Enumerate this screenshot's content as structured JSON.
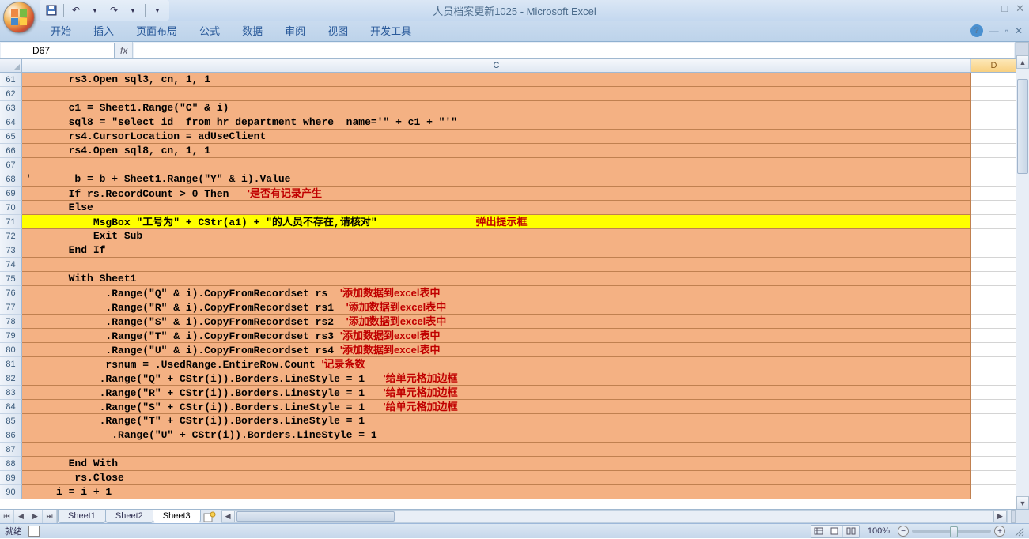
{
  "title": "人员档案更新1025 - Microsoft Excel",
  "qat": {
    "save": "save-icon",
    "undo": "undo-icon",
    "redo": "redo-icon"
  },
  "ribbon_tabs": [
    "开始",
    "插入",
    "页面布局",
    "公式",
    "数据",
    "审阅",
    "视图",
    "开发工具"
  ],
  "namebox": "D67",
  "formula_value": "",
  "columns": [
    "C",
    "D"
  ],
  "row_start": 61,
  "row_end": 90,
  "highlight_row": 71,
  "rows": [
    {
      "n": 61,
      "c": "       rs3.Open sql3, cn, 1, 1",
      "comment": ""
    },
    {
      "n": 62,
      "c": "",
      "comment": ""
    },
    {
      "n": 63,
      "c": "       c1 = Sheet1.Range(\"C\" & i)",
      "comment": ""
    },
    {
      "n": 64,
      "c": "       sql8 = \"select id  from hr_department where  name='\" + c1 + \"'\"",
      "comment": ""
    },
    {
      "n": 65,
      "c": "       rs4.CursorLocation = adUseClient",
      "comment": ""
    },
    {
      "n": 66,
      "c": "       rs4.Open sql8, cn, 1, 1",
      "comment": ""
    },
    {
      "n": 67,
      "c": "",
      "comment": ""
    },
    {
      "n": 68,
      "c": "'       b = b + Sheet1.Range(\"Y\" & i).Value",
      "comment": ""
    },
    {
      "n": 69,
      "c": "       If rs.RecordCount > 0 Then   ",
      "comment": "'是否有记录产生"
    },
    {
      "n": 70,
      "c": "       Else",
      "comment": ""
    },
    {
      "n": 71,
      "c": "           MsgBox \"工号为\" + CStr(a1) + \"的人员不存在,请核对\"                ",
      "comment": "弹出提示框"
    },
    {
      "n": 72,
      "c": "           Exit Sub",
      "comment": ""
    },
    {
      "n": 73,
      "c": "       End If",
      "comment": ""
    },
    {
      "n": 74,
      "c": "",
      "comment": ""
    },
    {
      "n": 75,
      "c": "       With Sheet1",
      "comment": ""
    },
    {
      "n": 76,
      "c": "             .Range(\"Q\" & i).CopyFromRecordset rs  ",
      "comment": "'添加数据到excel表中"
    },
    {
      "n": 77,
      "c": "             .Range(\"R\" & i).CopyFromRecordset rs1  ",
      "comment": "'添加数据到excel表中"
    },
    {
      "n": 78,
      "c": "             .Range(\"S\" & i).CopyFromRecordset rs2  ",
      "comment": "'添加数据到excel表中"
    },
    {
      "n": 79,
      "c": "             .Range(\"T\" & i).CopyFromRecordset rs3 ",
      "comment": "'添加数据到excel表中"
    },
    {
      "n": 80,
      "c": "             .Range(\"U\" & i).CopyFromRecordset rs4 ",
      "comment": "'添加数据到excel表中"
    },
    {
      "n": 81,
      "c": "             rsnum = .UsedRange.EntireRow.Count ",
      "comment": "'记录条数"
    },
    {
      "n": 82,
      "c": "            .Range(\"Q\" + CStr(i)).Borders.LineStyle = 1   ",
      "comment": "'给单元格加边框"
    },
    {
      "n": 83,
      "c": "            .Range(\"R\" + CStr(i)).Borders.LineStyle = 1   ",
      "comment": "'给单元格加边框"
    },
    {
      "n": 84,
      "c": "            .Range(\"S\" + CStr(i)).Borders.LineStyle = 1   ",
      "comment": "'给单元格加边框"
    },
    {
      "n": 85,
      "c": "            .Range(\"T\" + CStr(i)).Borders.LineStyle = 1",
      "comment": ""
    },
    {
      "n": 86,
      "c": "              .Range(\"U\" + CStr(i)).Borders.LineStyle = 1",
      "comment": ""
    },
    {
      "n": 87,
      "c": "",
      "comment": ""
    },
    {
      "n": 88,
      "c": "       End With",
      "comment": ""
    },
    {
      "n": 89,
      "c": "        rs.Close",
      "comment": ""
    },
    {
      "n": 90,
      "c": "     i = i + 1",
      "comment": ""
    }
  ],
  "sheet_tabs": [
    "Sheet1",
    "Sheet2",
    "Sheet3"
  ],
  "active_sheet": 2,
  "status": {
    "ready": "就绪",
    "zoom": "100%"
  }
}
